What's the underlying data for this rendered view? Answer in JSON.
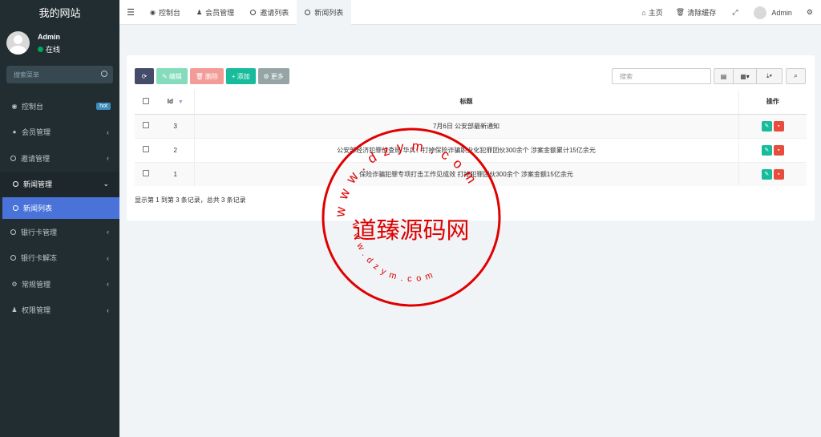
{
  "sidebar": {
    "logo": "我的网站",
    "user": {
      "name": "Admin",
      "status": "在线"
    },
    "search_placeholder": "搜索菜单",
    "items": [
      {
        "label": "控制台",
        "badge": "hot"
      },
      {
        "label": "会员管理"
      },
      {
        "label": "邀请管理"
      },
      {
        "label": "新闻管理"
      },
      {
        "label": "新闻列表"
      },
      {
        "label": "银行卡管理"
      },
      {
        "label": "银行卡解冻"
      },
      {
        "label": "常规管理"
      },
      {
        "label": "权限管理"
      }
    ]
  },
  "header": {
    "tabs": [
      {
        "label": "控制台"
      },
      {
        "label": "会员管理"
      },
      {
        "label": "邀请列表"
      },
      {
        "label": "新闻列表"
      }
    ],
    "right": {
      "home": "主页",
      "clear_cache": "清除缓存",
      "user": "Admin"
    }
  },
  "toolbar": {
    "edit": "编辑",
    "delete": "删除",
    "add": "添加",
    "more": "更多",
    "search_placeholder": "搜索"
  },
  "table": {
    "headers": {
      "id": "Id",
      "title": "标题",
      "op": "操作"
    },
    "rows": [
      {
        "id": "3",
        "title": "7月6日 公安部最新通知"
      },
      {
        "id": "2",
        "title": "公安部经济犯罪侦查局 华兵：打掉保险诈骗职业化犯罪团伙300余个 涉案金额累计15亿余元"
      },
      {
        "id": "1",
        "title": "保险诈骗犯罪专项打击工作见成效 打掉犯罪团伙300余个 涉案金额15亿余元"
      }
    ],
    "page_info": "显示第 1 到第 3 条记录，总共 3 条记录"
  },
  "watermark": {
    "text": "道臻源码网",
    "url_top": "www.dzym.com",
    "url_bottom": "www.dzym.com",
    "color": "#e00000"
  }
}
